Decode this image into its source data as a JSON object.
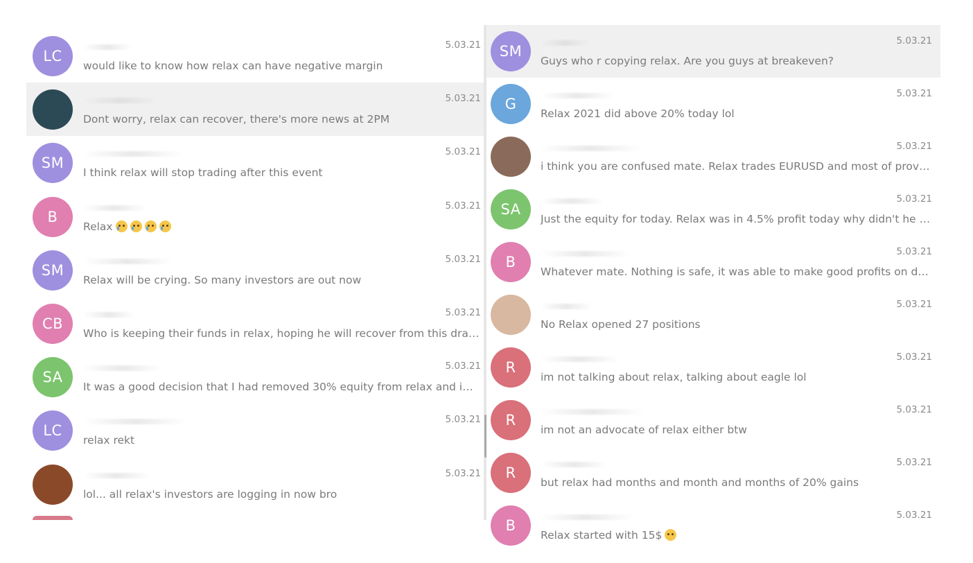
{
  "left_chats": [
    {
      "initials": "LC",
      "avatar_color": "#9f8fdf",
      "date": "5.03.21",
      "message": "would like to know how relax can have negative margin",
      "selected": false
    },
    {
      "initials": "",
      "avatar_color": "#2b4a55",
      "photo": true,
      "date": "5.03.21",
      "message": "Dont worry, relax can recover, there's more news at 2PM",
      "selected": true
    },
    {
      "initials": "SM",
      "avatar_color": "#9f8fdf",
      "date": "5.03.21",
      "message": "I think relax will stop trading after this event",
      "selected": false
    },
    {
      "initials": "B",
      "avatar_color": "#e07fb0",
      "date": "5.03.21",
      "message": "Relax",
      "emojis": [
        "crying-face-icon",
        "crying-face-icon",
        "crying-face-icon",
        "crying-face-icon"
      ],
      "selected": false
    },
    {
      "initials": "SM",
      "avatar_color": "#9f8fdf",
      "date": "5.03.21",
      "message": "Relax will be crying. So many investors are out now",
      "selected": false
    },
    {
      "initials": "CB",
      "avatar_color": "#e07fb0",
      "date": "5.03.21",
      "message": "Who is keeping their funds in relax, hoping he will recover from this drastic f...",
      "selected": false
    },
    {
      "initials": "SA",
      "avatar_color": "#7cc46e",
      "date": "5.03.21",
      "message": "It was a good decision that I had removed 30% equity from relax and invest...",
      "selected": false
    },
    {
      "initials": "LC",
      "avatar_color": "#9f8fdf",
      "date": "5.03.21",
      "message": "relax rekt",
      "selected": false
    },
    {
      "initials": "",
      "avatar_color": "#8a4a2a",
      "photo": true,
      "date": "5.03.21",
      "message": "lol... all relax's investors are logging in now bro",
      "selected": false
    }
  ],
  "right_chats": [
    {
      "initials": "SM",
      "avatar_color": "#9f8fdf",
      "date": "5.03.21",
      "message": "Guys who r copying relax. Are you guys at breakeven?",
      "selected": true
    },
    {
      "initials": "G",
      "avatar_color": "#6ba6dc",
      "date": "5.03.21",
      "message": "Relax 2021 did above 20% today lol",
      "selected": false
    },
    {
      "initials": "",
      "avatar_color": "#8a6a5a",
      "photo": true,
      "date": "5.03.21",
      "message": "i think you are confused mate.  Relax trades EURUSD and most of providers ...",
      "selected": false
    },
    {
      "initials": "SA",
      "avatar_color": "#7cc46e",
      "date": "5.03.21",
      "message": "Just the equity for today. Relax was in 4.5% profit today why didn't he close i...",
      "selected": false
    },
    {
      "initials": "B",
      "avatar_color": "#e07fb0",
      "date": "5.03.21",
      "message": "Whatever mate. Nothing is safe, it was able to make good profits on days lik...",
      "selected": false
    },
    {
      "initials": "",
      "avatar_color": "#d8b8a0",
      "photo": true,
      "date": "5.03.21",
      "message": "No Relax opened 27 positions",
      "selected": false
    },
    {
      "initials": "R",
      "avatar_color": "#d9707a",
      "date": "5.03.21",
      "message": "im not talking about relax, talking about eagle lol",
      "selected": false
    },
    {
      "initials": "R",
      "avatar_color": "#d9707a",
      "date": "5.03.21",
      "message": "im not an advocate of relax either btw",
      "selected": false
    },
    {
      "initials": "R",
      "avatar_color": "#d9707a",
      "date": "5.03.21",
      "message": "but relax had months and month and months of 20% gains",
      "selected": false
    },
    {
      "initials": "B",
      "avatar_color": "#e07fb0",
      "date": "5.03.21",
      "message": "Relax started with 15$",
      "emojis": [
        "winking-face-icon"
      ],
      "selected": false
    }
  ]
}
